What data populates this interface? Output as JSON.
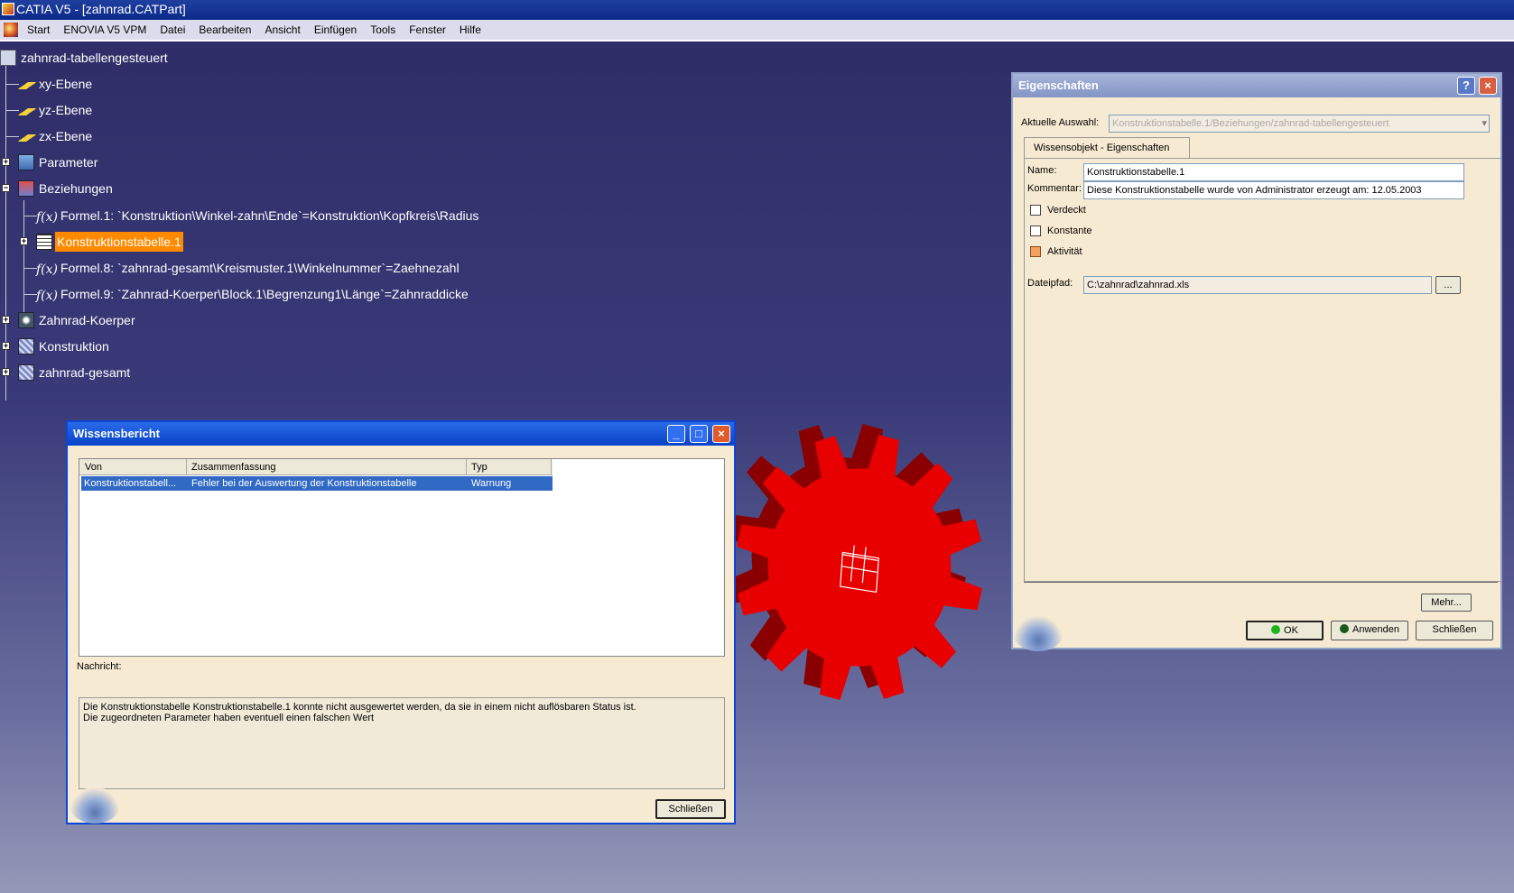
{
  "app": {
    "title": "CATIA V5 - [zahnrad.CATPart]"
  },
  "menu": {
    "items": [
      "Start",
      "ENOVIA V5 VPM",
      "Datei",
      "Bearbeiten",
      "Ansicht",
      "Einfügen",
      "Tools",
      "Fenster",
      "Hilfe"
    ]
  },
  "tree": {
    "root": "zahnrad-tabellengesteuert",
    "xy": "xy-Ebene",
    "yz": "yz-Ebene",
    "zx": "zx-Ebene",
    "parameter": "Parameter",
    "beziehungen": "Beziehungen",
    "formel1": "Formel.1: `Konstruktion\\Winkel-zahn\\Ende`=Konstruktion\\Kopfkreis\\Radius",
    "tabelle": "Konstruktionstabelle.1",
    "formel8": "Formel.8: `zahnrad-gesamt\\Kreismuster.1\\Winkelnummer`=Zaehnezahl",
    "formel9": "Formel.9: `Zahnrad-Koerper\\Block.1\\Begrenzung1\\Länge`=Zahnraddicke",
    "koerper": "Zahnrad-Koerper",
    "konstruktion": "Konstruktion",
    "gesamt": "zahnrad-gesamt",
    "formula_glyph": "f(x)"
  },
  "bericht": {
    "title": "Wissensbericht",
    "columns": [
      "Von",
      "Zusammenfassung",
      "Typ"
    ],
    "row": {
      "von": "Konstruktionstabell...",
      "zusammenfassung": "Fehler bei der Auswertung der Konstruktionstabelle",
      "typ": "Warnung"
    },
    "nachricht_label": "Nachricht:",
    "message_line1": "Die Konstruktionstabelle Konstruktionstabelle.1 konnte nicht ausgewertet werden, da sie in einem nicht auflösbaren Status ist.",
    "message_line2": "Die zugeordneten Parameter haben eventuell einen falschen Wert",
    "close": "Schließen"
  },
  "eigenschaften": {
    "title": "Eigenschaften",
    "help": "?",
    "auswahl_label": "Aktuelle Auswahl:",
    "auswahl_value": "Konstruktionstabelle.1/Beziehungen/zahnrad-tabellengesteuert",
    "tab": "Wissensobjekt - Eigenschaften",
    "name_label": "Name:",
    "name_value": "Konstruktionstabelle.1",
    "kommentar_label": "Kommentar:",
    "kommentar_value": "Diese Konstruktionstabelle wurde von Administrator erzeugt am: 12.05.2003",
    "verdeckt": "Verdeckt",
    "konstante": "Konstante",
    "aktivitaet": "Aktivität",
    "aktivitaet_checked": true,
    "dateipfad_label": "Dateipfad:",
    "dateipfad_value": "C:\\zahnrad\\zahnrad.xls",
    "browse": "...",
    "mehr": "Mehr...",
    "ok": "OK",
    "anwenden": "Anwenden",
    "schliessen": "Schließen"
  },
  "colors": {
    "gear": "#e80000",
    "gear_side": "#8a0000",
    "selection": "#ff8a00",
    "titlebar_blue": "#0a46d8"
  }
}
